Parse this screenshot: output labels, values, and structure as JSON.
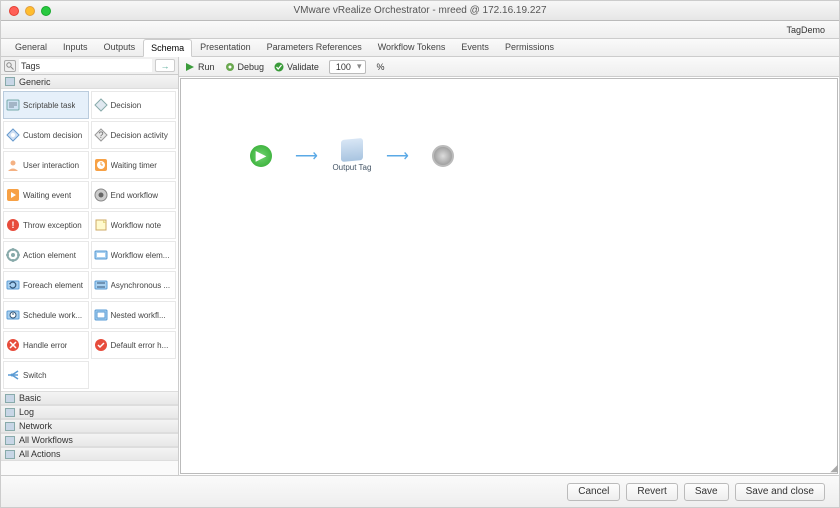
{
  "window": {
    "title": "VMware vRealize Orchestrator - mreed @ 172.16.19.227"
  },
  "context": {
    "workflow_name": "TagDemo"
  },
  "tabs": [
    "General",
    "Inputs",
    "Outputs",
    "Schema",
    "Presentation",
    "Parameters References",
    "Workflow Tokens",
    "Events",
    "Permissions"
  ],
  "active_tab": "Schema",
  "search": {
    "value": "Tags",
    "go": "→"
  },
  "categories": {
    "open": "Generic",
    "closed": [
      "Basic",
      "Log",
      "Network",
      "All Workflows",
      "All Actions"
    ]
  },
  "palette": [
    {
      "label": "Scriptable task",
      "icon": "script",
      "sel": true
    },
    {
      "label": "Decision",
      "icon": "decision"
    },
    {
      "label": "Custom decision",
      "icon": "custom-decision"
    },
    {
      "label": "Decision activity",
      "icon": "decision-activity"
    },
    {
      "label": "User interaction",
      "icon": "user-interaction"
    },
    {
      "label": "Waiting timer",
      "icon": "waiting-timer"
    },
    {
      "label": "Waiting event",
      "icon": "waiting-event"
    },
    {
      "label": "End workflow",
      "icon": "end-workflow"
    },
    {
      "label": "Throw exception",
      "icon": "throw-exception"
    },
    {
      "label": "Workflow note",
      "icon": "workflow-note"
    },
    {
      "label": "Action element",
      "icon": "action-element"
    },
    {
      "label": "Workflow elem...",
      "icon": "workflow-element"
    },
    {
      "label": "Foreach element",
      "icon": "foreach-element"
    },
    {
      "label": "Asynchronous ...",
      "icon": "asynchronous"
    },
    {
      "label": "Schedule work...",
      "icon": "schedule-workflow"
    },
    {
      "label": "Nested workfl...",
      "icon": "nested-workflow"
    },
    {
      "label": "Handle error",
      "icon": "handle-error"
    },
    {
      "label": "Default error h...",
      "icon": "default-error"
    },
    {
      "label": "Switch",
      "icon": "switch"
    }
  ],
  "toolbar": {
    "run": "Run",
    "debug": "Debug",
    "validate": "Validate",
    "zoom": "100",
    "zoom_suffix": "%"
  },
  "workflow": {
    "mid_label": "Output Tag"
  },
  "footer": {
    "cancel": "Cancel",
    "revert": "Revert",
    "save": "Save",
    "save_close": "Save and close"
  }
}
